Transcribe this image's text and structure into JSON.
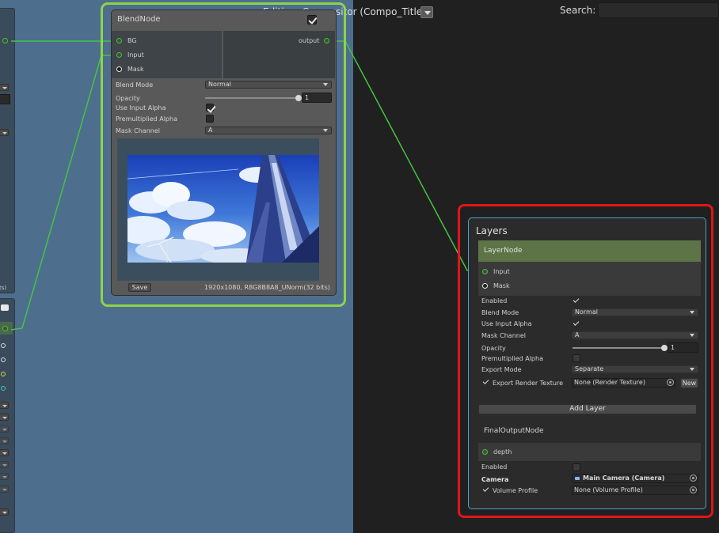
{
  "header": {
    "editing_label": "Editing: Compositor (Compo_Title)",
    "search_label": "Search:",
    "search_value": ""
  },
  "left_panels": {
    "partial_text": "ts)"
  },
  "blend_node": {
    "title": "BlendNode",
    "enabled": true,
    "inputs": [
      "BG",
      "Input",
      "Mask"
    ],
    "output": "output",
    "properties": {
      "blend_mode_label": "Blend Mode",
      "blend_mode_value": "Normal",
      "opacity_label": "Opacity",
      "opacity_value": "1",
      "opacity_fraction": 1,
      "use_input_alpha_label": "Use Input Alpha",
      "use_input_alpha": true,
      "premultiplied_alpha_label": "Premultiplied Alpha",
      "premultiplied_alpha": false,
      "mask_channel_label": "Mask Channel",
      "mask_channel_value": "A"
    },
    "save_label": "Save",
    "resolution_label": "1920x1080, R8G8B8A8_UNorm(32 bits)"
  },
  "layers_panel": {
    "title": "Layers",
    "layer_node": {
      "title": "LayerNode",
      "inputs": [
        "Input",
        "Mask"
      ],
      "enabled_label": "Enabled",
      "enabled": true,
      "blend_mode_label": "Blend Mode",
      "blend_mode_value": "Normal",
      "use_input_alpha_label": "Use Input Alpha",
      "use_input_alpha": true,
      "mask_channel_label": "Mask Channel",
      "mask_channel_value": "A",
      "opacity_label": "Opacity",
      "opacity_value": "1",
      "opacity_fraction": 1,
      "premultiplied_alpha_label": "Premultiplied Alpha",
      "premultiplied_alpha": false,
      "export_mode_label": "Export Mode",
      "export_mode_value": "Separate",
      "export_render_texture_label": "Export Render Texture",
      "export_render_texture_value": "None (Render Texture)",
      "new_label": "New"
    },
    "add_layer_label": "Add Layer",
    "final_output_node": {
      "title": "FinalOutputNode",
      "input": "depth",
      "enabled_label": "Enabled",
      "enabled": false,
      "camera_label": "Camera",
      "camera_value": "Main Camera (Camera)",
      "volume_profile_label": "Volume Profile",
      "volume_profile_value": "None (Volume Profile)"
    }
  },
  "colors": {
    "graph_background": "#4e6e8e",
    "blend_highlight": "#8ed34a",
    "layers_highlight": "#e01616",
    "connection": "#43c443",
    "layer_header": "#5c7446"
  }
}
